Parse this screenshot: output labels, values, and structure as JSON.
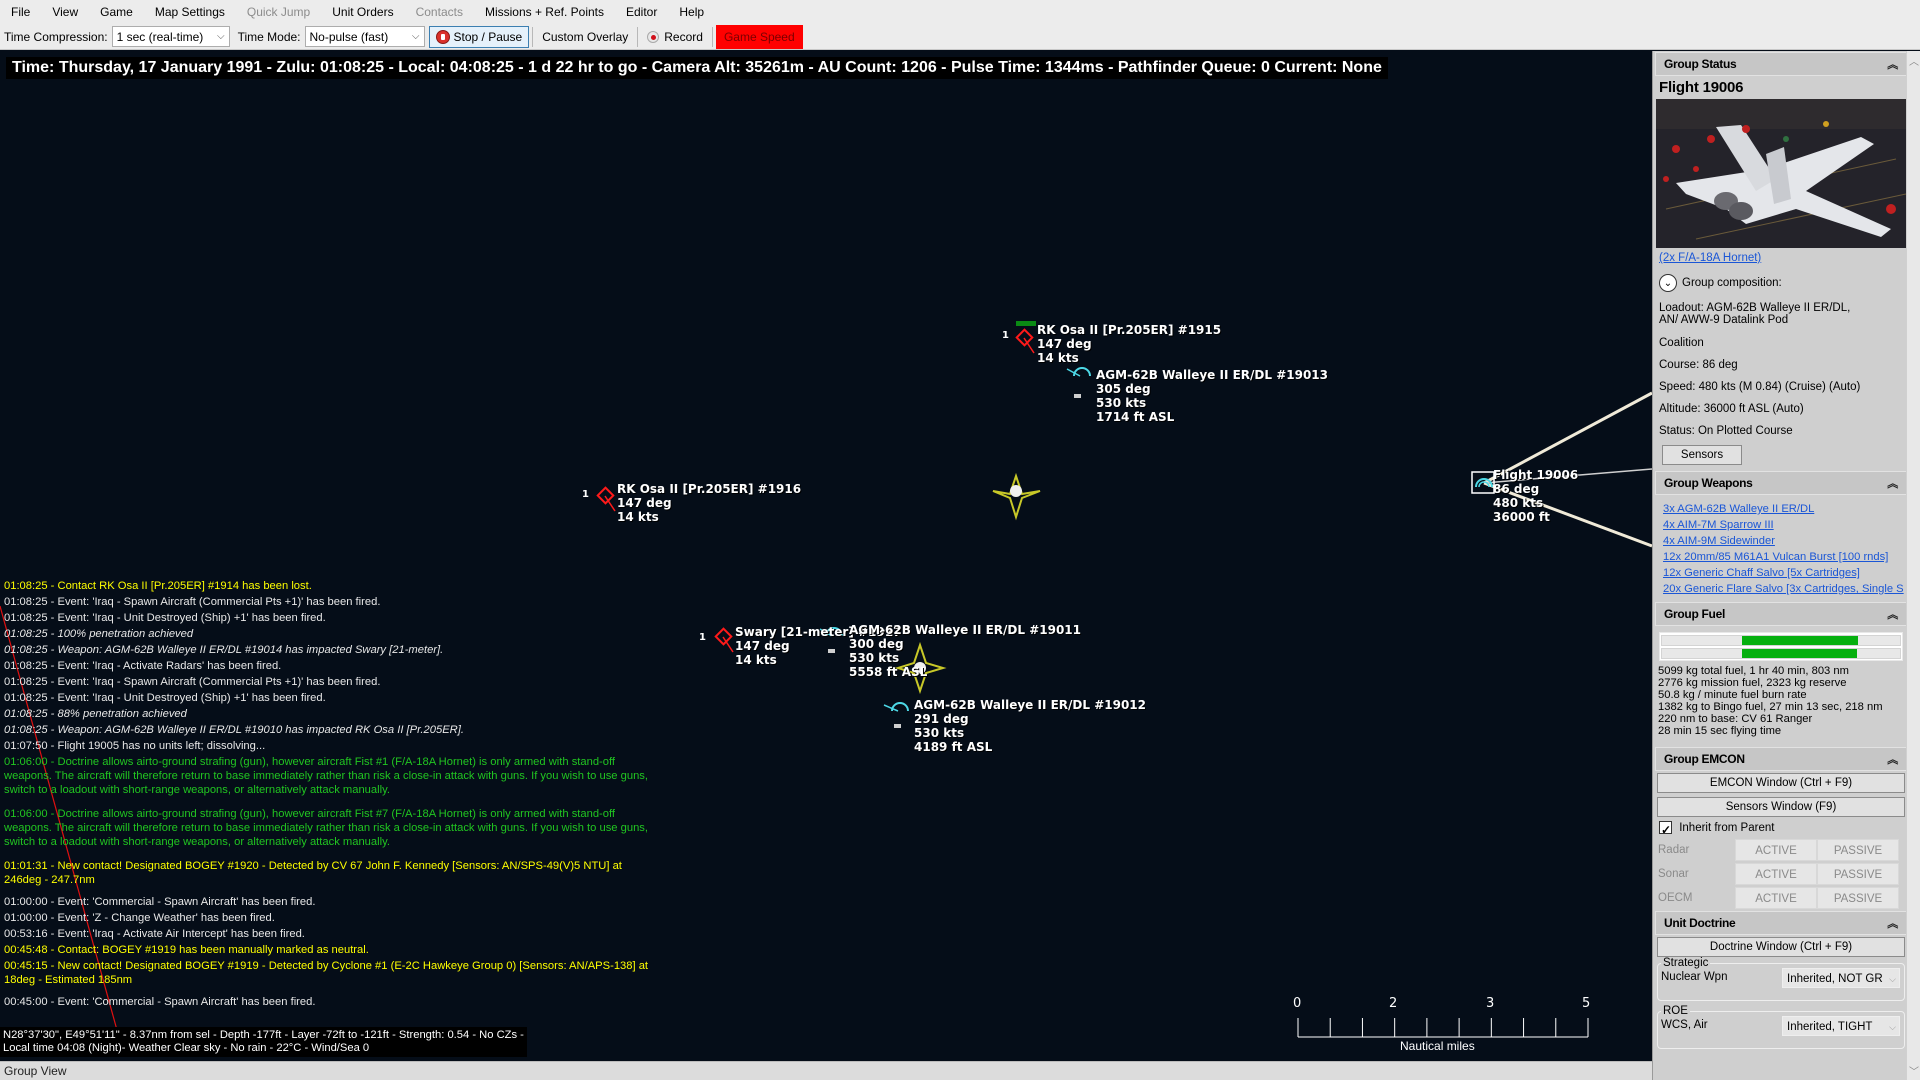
{
  "menu": [
    "File",
    "View",
    "Game",
    "Map Settings",
    "Quick Jump",
    "Unit Orders",
    "Contacts",
    "Missions + Ref. Points",
    "Editor",
    "Help"
  ],
  "menu_disabled": [
    "Quick Jump",
    "Contacts"
  ],
  "toolbar": {
    "time_compression_label": "Time Compression:",
    "time_compression_value": "1 sec (real-time)",
    "time_mode_label": "Time Mode:",
    "time_mode_value": "No-pulse (fast)",
    "stop_pause_label": "Stop / Pause",
    "custom_overlay_label": "Custom Overlay",
    "record_label": "Record",
    "game_speed_label": "Game Speed"
  },
  "status_line": "Time: Thursday, 17 January 1991 - Zulu: 01:08:25 - Local: 04:08:25 - 1 d 22 hr to go -  Camera Alt: 35261m - AU Count: 1206 - Pulse Time: 1344ms - Pathfinder Queue: 0 Current: None",
  "map_units": [
    {
      "id": "osa-1915",
      "type": "ship-hostile",
      "count": "1",
      "lines": [
        "RK Osa II [Pr.205ER] #1915",
        "147 deg",
        "14 kts"
      ]
    },
    {
      "id": "walleye-19013",
      "type": "weapon",
      "lines": [
        "AGM-62B Walleye II ER/DL #19013",
        "305 deg",
        "530 kts",
        "1714 ft ASL"
      ]
    },
    {
      "id": "osa-1916",
      "type": "ship-hostile",
      "count": "1",
      "lines": [
        "RK Osa II [Pr.205ER] #1916",
        "147 deg",
        "14 kts"
      ]
    },
    {
      "id": "swary",
      "type": "ship-hostile",
      "count": "1",
      "lines": [
        "Swary [21-meter] #1917",
        "147 deg",
        "14 kts"
      ]
    },
    {
      "id": "walleye-19011",
      "type": "weapon",
      "lines": [
        "AGM-62B Walleye II ER/DL #19011",
        "300 deg",
        "530 kts",
        "5558 ft ASL"
      ]
    },
    {
      "id": "walleye-19012",
      "type": "weapon",
      "lines": [
        "AGM-62B Walleye II ER/DL #19012",
        "291 deg",
        "530 kts",
        "4189 ft ASL"
      ]
    },
    {
      "id": "flight-19006",
      "type": "aircraft-friendly",
      "lines": [
        "Flight 19006",
        "86 deg",
        "480 kts",
        "36000 ft"
      ]
    }
  ],
  "message_log": [
    {
      "style": "yellow",
      "text": "01:08:25 - Contact RK Osa II [Pr.205ER] #1914 has been lost."
    },
    {
      "style": "white",
      "text": "01:08:25 - Event: 'Iraq - Spawn Aircraft (Commercial Pts +1)' has been fired."
    },
    {
      "style": "white",
      "text": "01:08:25 - Event: 'Iraq - Unit Destroyed (Ship) +1' has been fired."
    },
    {
      "style": "italic",
      "text": "01:08:25 - 100% penetration achieved"
    },
    {
      "style": "italic",
      "text": "01:08:25 - Weapon: AGM-62B Walleye II ER/DL #19014 has impacted Swary [21-meter]."
    },
    {
      "style": "white",
      "text": "01:08:25 - Event: 'Iraq - Activate Radars' has been fired."
    },
    {
      "style": "white",
      "text": "01:08:25 - Event: 'Iraq - Spawn Aircraft (Commercial Pts +1)' has been fired."
    },
    {
      "style": "white",
      "text": "01:08:25 - Event: 'Iraq - Unit Destroyed (Ship) +1' has been fired."
    },
    {
      "style": "italic",
      "text": "01:08:25 - 88% penetration achieved"
    },
    {
      "style": "italic",
      "text": "01:08:25 - Weapon: AGM-62B Walleye II ER/DL #19010 has impacted RK Osa II [Pr.205ER]."
    },
    {
      "style": "white",
      "text": "01:07:50 - Flight 19005 has no units left; dissolving..."
    },
    {
      "style": "green",
      "text": "01:06:00 - Doctrine allows airto-ground strafing (gun), however aircraft Fist #1 (F/A-18A Hornet) is only armed with stand-off weapons. The aircraft will therefore return to base immediately rather than risk a close-in attack with guns. If you wish to use guns, switch to a loadout with short-range weapons, or alternatively attack manually."
    },
    {
      "style": "green",
      "text": "01:06:00 - Doctrine allows airto-ground strafing (gun), however aircraft Fist #7 (F/A-18A Hornet) is only armed with stand-off weapons. The aircraft will therefore return to base immediately rather than risk a close-in attack with guns. If you wish to use guns, switch to a loadout with short-range weapons, or alternatively attack manually."
    },
    {
      "style": "yellow gap",
      "text": "01:01:31 - New contact! Designated BOGEY #1920 - Detected by CV 67 John F. Kennedy  [Sensors: AN/SPS-49(V)5 NTU] at 246deg - 247.7nm"
    },
    {
      "style": "white",
      "text": "01:00:00 - Event: 'Commercial - Spawn Aircraft' has been fired."
    },
    {
      "style": "white",
      "text": "01:00:00 - Event: 'Z - Change Weather' has been fired."
    },
    {
      "style": "white",
      "text": "00:53:16 - Event: 'Iraq - Activate Air Intercept' has been fired."
    },
    {
      "style": "yellow",
      "text": "00:45:48 - Contact: BOGEY #1919 has been manually marked as neutral."
    },
    {
      "style": "yellow gap",
      "text": "00:45:15 - New contact! Designated BOGEY #1919 - Detected by Cyclone #1 (E-2C Hawkeye Group 0)  [Sensors: AN/APS-138] at 18deg - Estimated 185nm"
    },
    {
      "style": "white",
      "text": "00:45:00 - Event: 'Commercial - Spawn Aircraft' has been fired."
    }
  ],
  "cursor_info": {
    "line1": "N28°37'30\", E49°51'11\" - 8.37nm from sel - Depth -177ft - Layer -72ft to -121ft - Strength: 0.54 - No CZs -",
    "line2": "Local time 04:08 (Night)- Weather Clear sky - No rain - 22°C - Wind/Sea 0"
  },
  "scale_bar": {
    "labels": [
      "0",
      "2",
      "3",
      "5"
    ],
    "unit": "Nautical miles"
  },
  "footer": {
    "label": "Group View"
  },
  "panel": {
    "group_status": {
      "header": "Group Status",
      "name": "Flight 19006",
      "composition_link": "(2x F/A-18A Hornet)",
      "composition_label": "Group composition:",
      "loadout": "Loadout: AGM-62B Walleye II ER/DL, AN/ AWW-9 Datalink Pod",
      "side": "Coalition",
      "course": "Course: 86 deg",
      "speed": "Speed: 480 kts (M 0.84) (Cruise)   (Auto)",
      "altitude": "Altitude: 36000 ft ASL   (Auto)",
      "status": "Status: On Plotted Course",
      "sensors_button": "Sensors"
    },
    "group_weapons": {
      "header": "Group Weapons",
      "items": [
        "3x AGM-62B Walleye II ER/DL",
        "4x AIM-7M Sparrow III",
        "4x AIM-9M Sidewinder",
        "12x 20mm/85 M61A1 Vulcan Burst [100 rnds]",
        "12x Generic Chaff Salvo [5x Cartridges]",
        "20x Generic Flare Salvo [3x Cartridges, Single S"
      ]
    },
    "group_fuel": {
      "header": "Group Fuel",
      "bars": [
        {
          "empty_fraction": 0.335,
          "full_fraction": 0.825
        },
        {
          "empty_fraction": 0.335,
          "full_fraction": 0.818
        }
      ],
      "lines": [
        "5099 kg total fuel, 1 hr 40 min, 803 nm",
        "2776 kg mission fuel, 2323 kg reserve",
        "50.8 kg / minute fuel burn rate",
        "1382 kg to Bingo fuel, 27 min 13 sec, 218 nm",
        "220 nm to base: CV 61 Ranger",
        "28 min 15 sec flying time"
      ]
    },
    "group_emcon": {
      "header": "Group EMCON",
      "emcon_window_button": "EMCON Window (Ctrl + F9)",
      "sensors_window_button": "Sensors Window (F9)",
      "inherit_label": "Inherit from Parent",
      "inherit_checked": true,
      "rows": [
        {
          "label": "Radar",
          "active": "ACTIVE",
          "passive": "PASSIVE"
        },
        {
          "label": "Sonar",
          "active": "ACTIVE",
          "passive": "PASSIVE"
        },
        {
          "label": "OECM",
          "active": "ACTIVE",
          "passive": "PASSIVE"
        }
      ]
    },
    "unit_doctrine": {
      "header": "Unit Doctrine",
      "doctrine_window_button": "Doctrine Window (Ctrl + F9)",
      "strategic_title": "Strategic",
      "nuclear_label": "Nuclear Wpn",
      "nuclear_value": "Inherited, NOT GR",
      "roe_title": "ROE",
      "wcs_air_label": "WCS, Air",
      "wcs_air_value": "Inherited, TIGHT"
    }
  },
  "colors": {
    "map_bg": "#050d18",
    "hostile": "#ff1a1a",
    "friendly": "#4dd8e6",
    "ref_point": "#c8c828",
    "log_yellow": "#ffff00",
    "log_green": "#21c521",
    "game_speed_bg": "#ff0000",
    "link": "#1a56d6",
    "fuel_fill": "#06b00f"
  }
}
